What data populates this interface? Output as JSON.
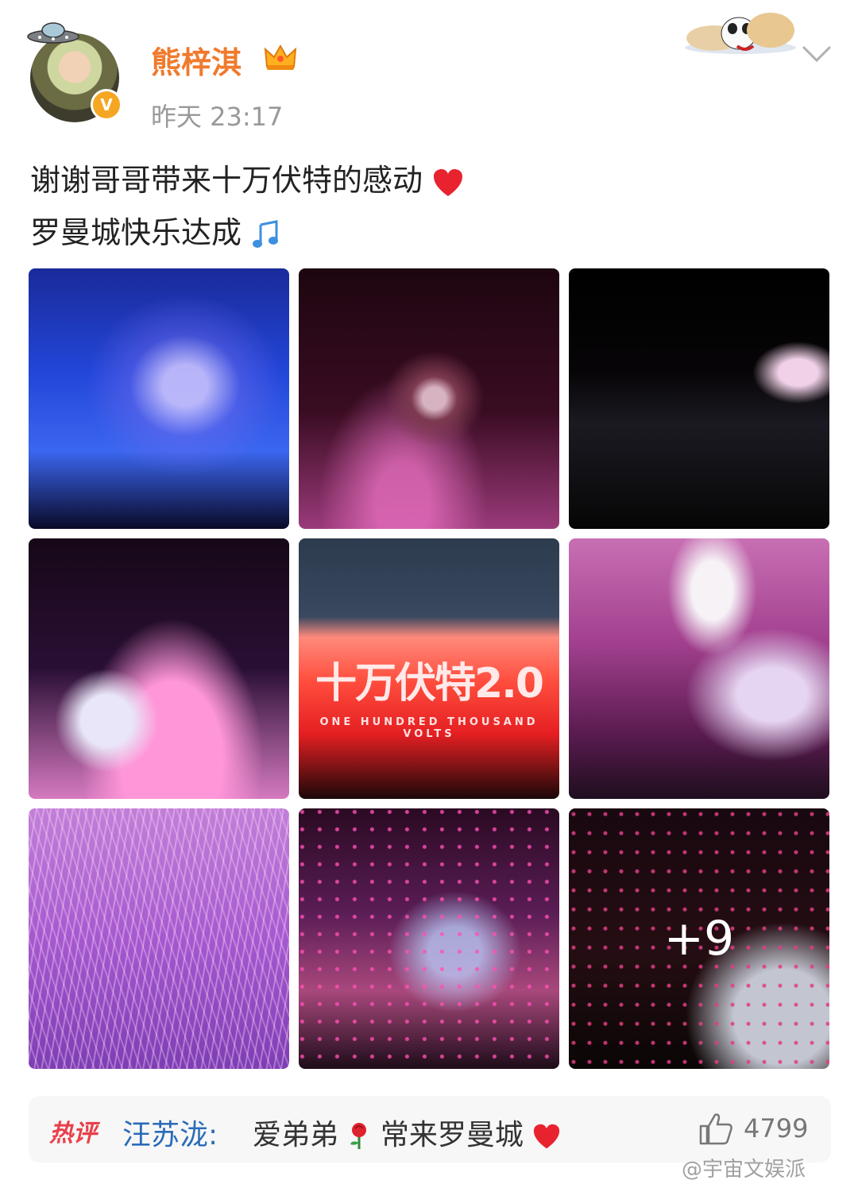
{
  "post": {
    "username": "熊梓淇",
    "verified_badge": "V",
    "timestamp": "昨天 23:17",
    "text_line1": "谢谢哥哥带来十万伏特的感动",
    "text_line1_emoji": "red-heart",
    "text_line2": "罗曼城快乐达成",
    "text_line2_emoji": "music-note"
  },
  "images": {
    "count_visible": 9,
    "banner_text_cn": "十万伏特2.0",
    "banner_text_en": "ONE HUNDRED THOUSAND VOLTS",
    "more_count": "+9"
  },
  "hot_comment": {
    "tag": "热评",
    "user": "汪苏泷",
    "separator": ":",
    "text_a": "爱弟弟",
    "emoji_a": "rose",
    "text_b": "常来罗曼城",
    "emoji_b": "red-heart",
    "like_count": "4799"
  },
  "watermark": "@宇宙文娱派",
  "colors": {
    "username": "#f07a2d",
    "timestamp": "#999999",
    "hot_tag": "#e8404a",
    "comment_user": "#2a6bb8",
    "verified": "#f5a623"
  }
}
